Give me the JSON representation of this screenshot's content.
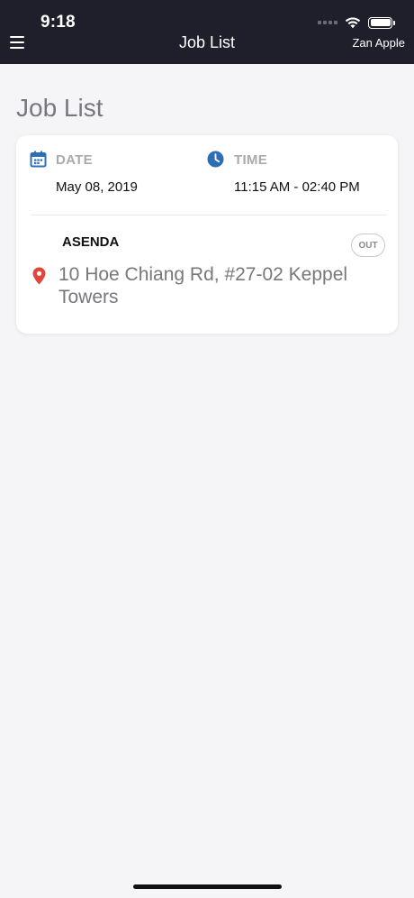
{
  "status_bar": {
    "time": "9:18"
  },
  "nav": {
    "title": "Job List",
    "user": "Zan Apple"
  },
  "page": {
    "title": "Job List"
  },
  "job": {
    "date_label": "DATE",
    "date_value": "May 08, 2019",
    "time_label": "TIME",
    "time_value": "11:15 AM - 02:40 PM",
    "company": "ASENDA",
    "status_badge": "OUT",
    "address": "10 Hoe Chiang Rd, #27-02 Keppel Towers"
  },
  "colors": {
    "nav_background": "#1f1f2b",
    "page_background": "#f5f5f7",
    "calendar_icon": "#2f6db5",
    "clock_icon": "#2f6db5",
    "pin_icon": "#e0463a"
  },
  "icons": {
    "menu": "hamburger-menu-icon",
    "date": "calendar-icon",
    "time": "clock-icon",
    "location": "map-pin-icon",
    "wifi": "wifi-icon",
    "battery": "battery-icon"
  }
}
